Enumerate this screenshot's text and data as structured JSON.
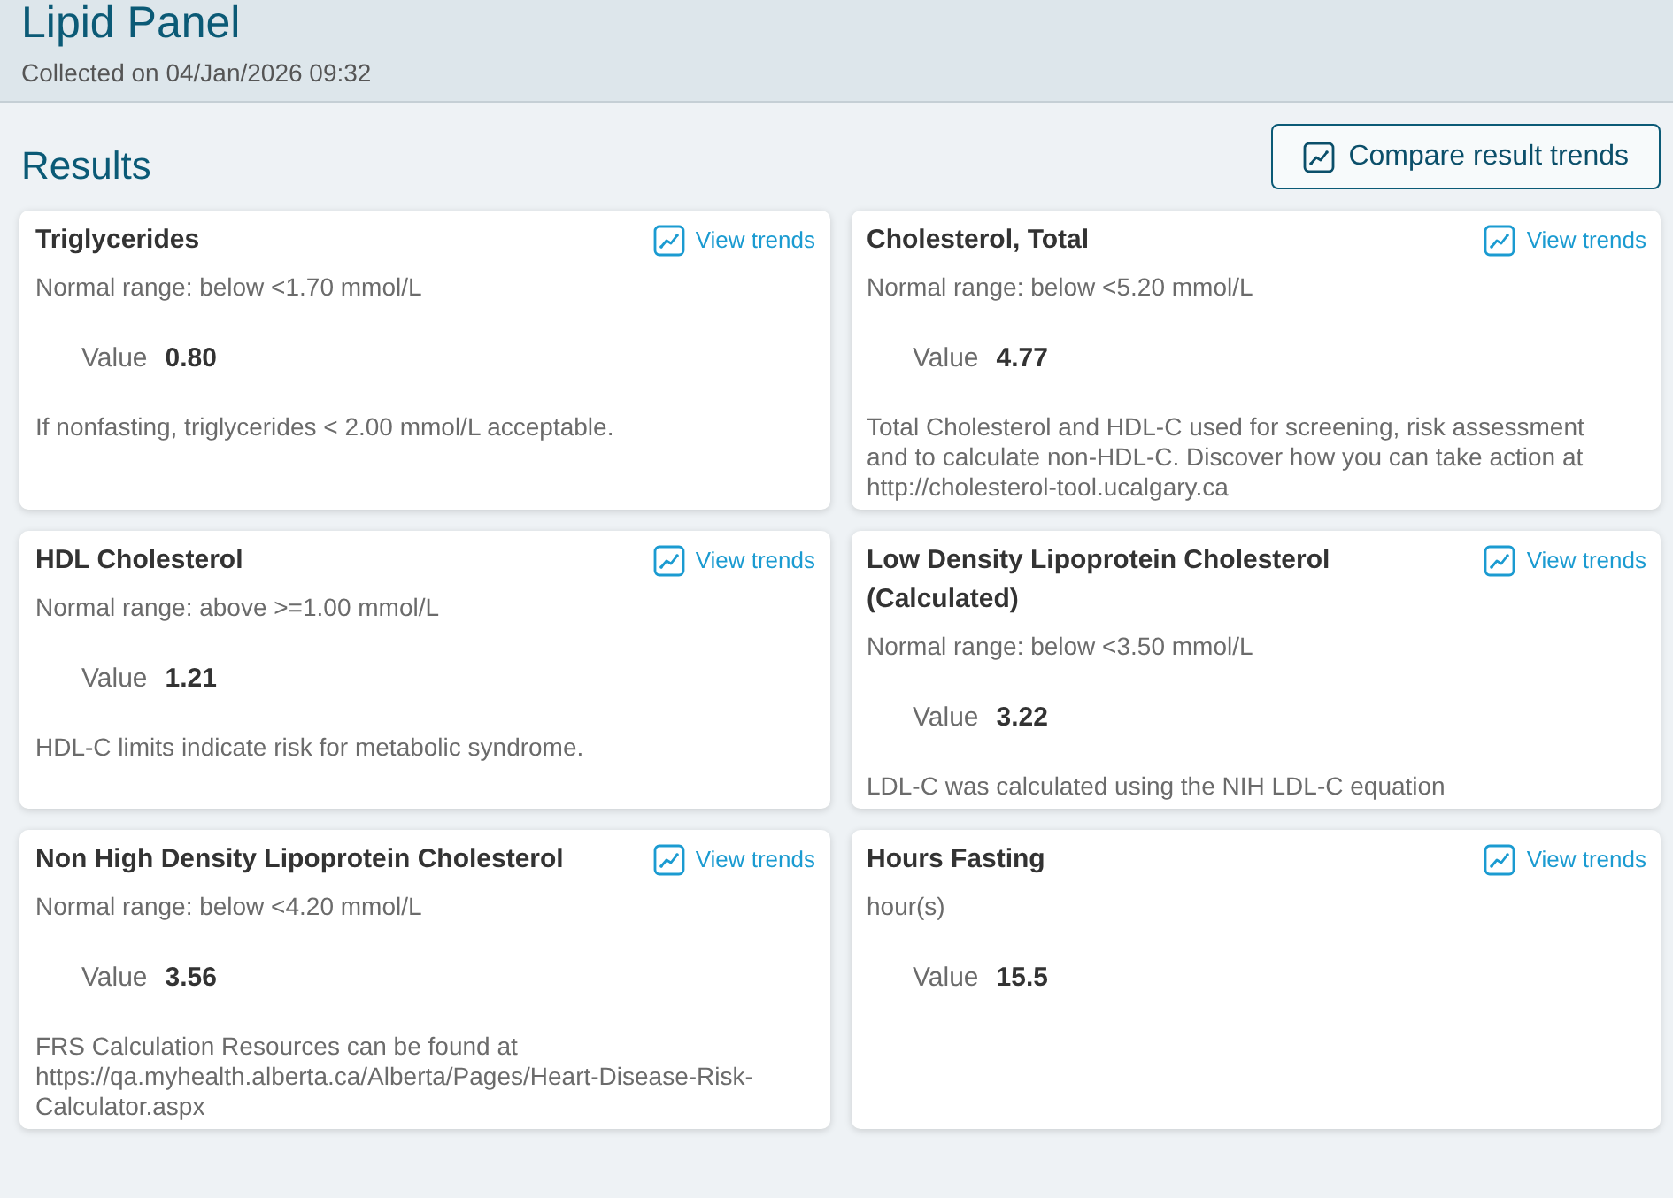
{
  "header": {
    "title": "Lipid Panel",
    "collected": "Collected on 04/Jan/2026 09:32"
  },
  "results": {
    "heading": "Results",
    "compare_button": "Compare result trends",
    "cards": [
      {
        "name": "Triglycerides",
        "trends_link": "View trends",
        "detail": "Normal range: below <1.70 mmol/L",
        "value_label": "Value",
        "value": "0.80",
        "note": "If nonfasting, triglycerides < 2.00 mmol/L acceptable."
      },
      {
        "name": "Cholesterol, Total",
        "trends_link": "View trends",
        "detail": "Normal range: below <5.20 mmol/L",
        "value_label": "Value",
        "value": "4.77",
        "note": "Total Cholesterol and HDL-C used for screening, risk assessment and to calculate non-HDL-C. Discover how you can take action at http://cholesterol-tool.ucalgary.ca"
      },
      {
        "name": "HDL Cholesterol",
        "trends_link": "View trends",
        "detail": "Normal range: above >=1.00 mmol/L",
        "value_label": "Value",
        "value": "1.21",
        "note": "HDL-C limits indicate risk for metabolic syndrome."
      },
      {
        "name": "Low Density Lipoprotein Cholesterol (Calculated)",
        "trends_link": "View trends",
        "detail": "Normal range: below <3.50 mmol/L",
        "value_label": "Value",
        "value": "3.22",
        "note": "LDL-C was calculated using the NIH LDL-C equation"
      },
      {
        "name": "Non High Density Lipoprotein Cholesterol",
        "trends_link": "View trends",
        "detail": "Normal range: below <4.20 mmol/L",
        "value_label": "Value",
        "value": "3.56",
        "note": "FRS Calculation Resources can be found at https://qa.myhealth.alberta.ca/Alberta/Pages/Heart-Disease-Risk-Calculator.aspx"
      },
      {
        "name": "Hours Fasting",
        "trends_link": "View trends",
        "detail": "hour(s)",
        "value_label": "Value",
        "value": "15.5"
      }
    ]
  }
}
